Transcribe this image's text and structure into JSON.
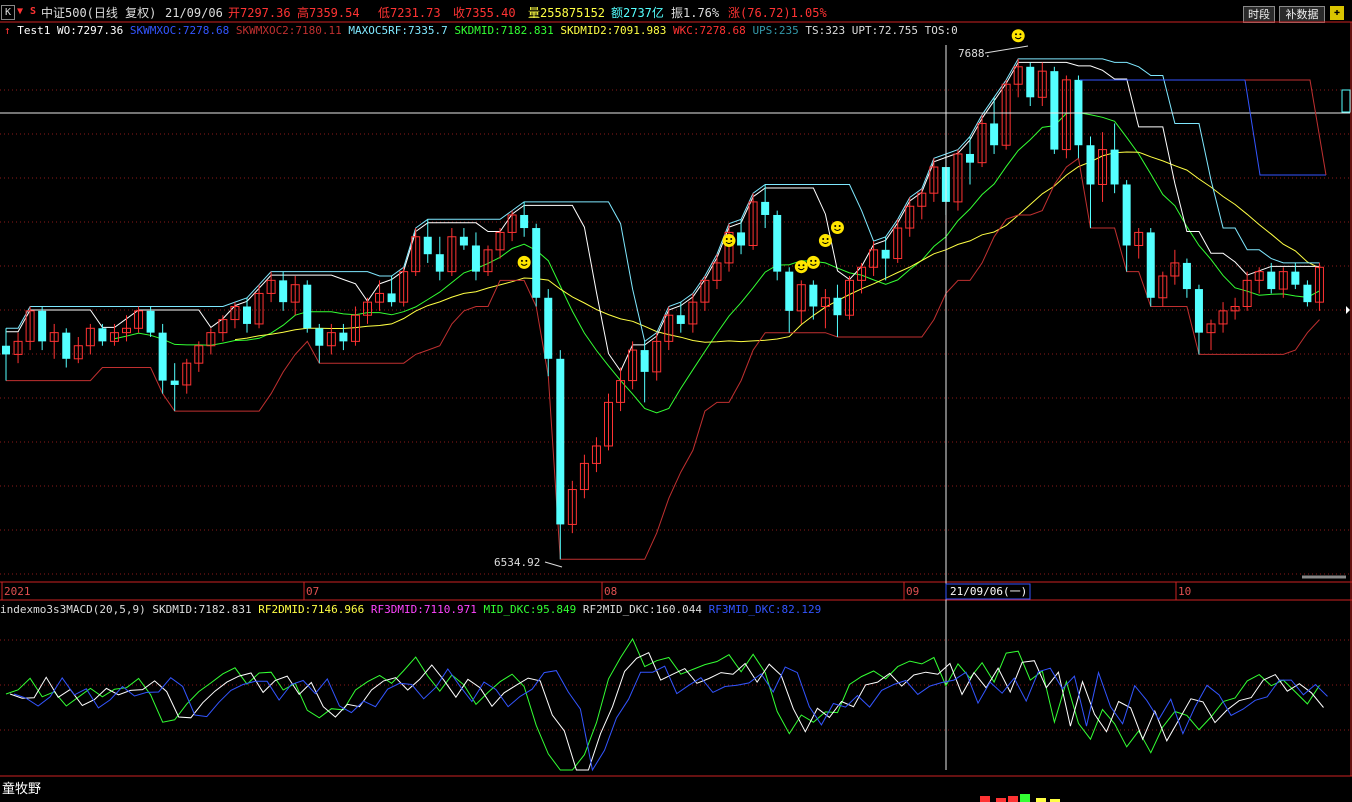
{
  "top": {
    "icons": [
      "K",
      "S"
    ],
    "stock_name": "中证500(日线 复权)",
    "date": "21/09/06",
    "open": "开7297.36",
    "high": "高7359.54",
    "low": "低7231.73",
    "close": "收7355.40",
    "volume": "量255875152",
    "amount": "额2737亿",
    "amplitude": "振1.76%",
    "change": "涨(76.72)1.05%",
    "buttons": [
      "时段",
      "补数据"
    ]
  },
  "legend_main": [
    {
      "text": "Test1",
      "color": "#ffffff"
    },
    {
      "text": "WO:7297.36",
      "color": "#ffffff"
    },
    {
      "text": "SKWMXOC:7278.68",
      "color": "#3355ff"
    },
    {
      "text": "SKWMXOC2:7180.11",
      "color": "#c03030"
    },
    {
      "text": "MAXOC5RF:7335.7",
      "color": "#7fe8ff"
    },
    {
      "text": "SKDMID:7182.831",
      "color": "#33ff33"
    },
    {
      "text": "SKDMID2:7091.983",
      "color": "#ffff44"
    },
    {
      "text": "WKC:7278.68",
      "color": "#ff3333"
    },
    {
      "text": "UPS:235",
      "color": "#3399aa"
    },
    {
      "text": "TS:323",
      "color": "#dddddd"
    },
    {
      "text": "UPT:72.755",
      "color": "#dddddd"
    },
    {
      "text": "TOS:0",
      "color": "#dddddd"
    }
  ],
  "price_labels": {
    "high": "7688.",
    "low": "6534.92"
  },
  "months": [
    "2021",
    "07",
    "08",
    "09",
    "21/09/06(一)",
    "10"
  ],
  "legend_sub": [
    {
      "text": "indexmo3s3MACD(20,5,9)",
      "color": "#dddddd"
    },
    {
      "text": "SKDMID:7182.831",
      "color": "#dddddd"
    },
    {
      "text": "RF2DMID:7146.966",
      "color": "#ffff44"
    },
    {
      "text": "RF3DMID:7110.971",
      "color": "#ff44ff"
    },
    {
      "text": "MID_DKC:95.849",
      "color": "#33ff33"
    },
    {
      "text": "RF2MID_DKC:160.044",
      "color": "#dddddd"
    },
    {
      "text": "RF3MID_DKC:82.129",
      "color": "#3355ff"
    }
  ],
  "bottom_name": "童牧野",
  "colors": {
    "up": "#ff3333",
    "down": "#54ffff",
    "grid": "#8b1a1a",
    "border": "#cc2222"
  },
  "candles": [
    [
      7030,
      7070,
      6950,
      7010
    ],
    [
      7010,
      7060,
      6990,
      7040
    ],
    [
      7040,
      7120,
      7020,
      7110
    ],
    [
      7110,
      7120,
      7020,
      7040
    ],
    [
      7040,
      7080,
      7000,
      7060
    ],
    [
      7060,
      7070,
      6980,
      7000
    ],
    [
      7000,
      7050,
      6990,
      7030
    ],
    [
      7030,
      7080,
      7010,
      7070
    ],
    [
      7070,
      7080,
      7030,
      7040
    ],
    [
      7040,
      7080,
      7030,
      7060
    ],
    [
      7060,
      7100,
      7040,
      7070
    ],
    [
      7070,
      7120,
      7060,
      7110
    ],
    [
      7110,
      7120,
      7050,
      7060
    ],
    [
      7060,
      7080,
      6920,
      6950
    ],
    [
      6950,
      6990,
      6880,
      6940
    ],
    [
      6940,
      7000,
      6920,
      6990
    ],
    [
      6990,
      7040,
      6970,
      7030
    ],
    [
      7030,
      7070,
      7010,
      7060
    ],
    [
      7060,
      7100,
      7040,
      7090
    ],
    [
      7090,
      7130,
      7070,
      7120
    ],
    [
      7120,
      7140,
      7060,
      7080
    ],
    [
      7080,
      7170,
      7070,
      7150
    ],
    [
      7150,
      7200,
      7130,
      7180
    ],
    [
      7180,
      7200,
      7110,
      7130
    ],
    [
      7130,
      7190,
      7100,
      7170
    ],
    [
      7170,
      7180,
      7060,
      7070
    ],
    [
      7070,
      7080,
      6990,
      7030
    ],
    [
      7030,
      7080,
      7010,
      7060
    ],
    [
      7060,
      7080,
      7020,
      7040
    ],
    [
      7040,
      7120,
      7030,
      7100
    ],
    [
      7100,
      7140,
      7080,
      7130
    ],
    [
      7130,
      7180,
      7110,
      7150
    ],
    [
      7150,
      7190,
      7120,
      7130
    ],
    [
      7130,
      7210,
      7120,
      7200
    ],
    [
      7200,
      7300,
      7190,
      7280
    ],
    [
      7280,
      7320,
      7220,
      7240
    ],
    [
      7240,
      7280,
      7180,
      7200
    ],
    [
      7200,
      7300,
      7190,
      7280
    ],
    [
      7280,
      7300,
      7250,
      7260
    ],
    [
      7260,
      7290,
      7180,
      7200
    ],
    [
      7200,
      7260,
      7190,
      7250
    ],
    [
      7250,
      7300,
      7230,
      7290
    ],
    [
      7290,
      7340,
      7270,
      7330
    ],
    [
      7330,
      7360,
      7280,
      7300
    ],
    [
      7300,
      7310,
      7120,
      7140
    ],
    [
      7140,
      7160,
      6960,
      7000
    ],
    [
      7000,
      7020,
      6540,
      6620
    ],
    [
      6620,
      6720,
      6600,
      6700
    ],
    [
      6700,
      6780,
      6680,
      6760
    ],
    [
      6760,
      6820,
      6740,
      6800
    ],
    [
      6800,
      6920,
      6790,
      6900
    ],
    [
      6900,
      6980,
      6880,
      6950
    ],
    [
      6950,
      7040,
      6930,
      7020
    ],
    [
      7020,
      7040,
      6900,
      6970
    ],
    [
      6970,
      7060,
      6950,
      7040
    ],
    [
      7040,
      7120,
      7020,
      7100
    ],
    [
      7100,
      7130,
      7060,
      7080
    ],
    [
      7080,
      7150,
      7060,
      7130
    ],
    [
      7130,
      7190,
      7110,
      7180
    ],
    [
      7180,
      7240,
      7160,
      7220
    ],
    [
      7220,
      7310,
      7200,
      7290
    ],
    [
      7290,
      7320,
      7240,
      7260
    ],
    [
      7260,
      7380,
      7250,
      7360
    ],
    [
      7360,
      7400,
      7300,
      7330
    ],
    [
      7330,
      7340,
      7180,
      7200
    ],
    [
      7200,
      7210,
      7060,
      7110
    ],
    [
      7110,
      7180,
      7080,
      7170
    ],
    [
      7170,
      7180,
      7090,
      7120
    ],
    [
      7120,
      7160,
      7070,
      7140
    ],
    [
      7140,
      7170,
      7050,
      7100
    ],
    [
      7100,
      7190,
      7090,
      7180
    ],
    [
      7180,
      7220,
      7150,
      7210
    ],
    [
      7210,
      7270,
      7190,
      7250
    ],
    [
      7250,
      7280,
      7180,
      7230
    ],
    [
      7230,
      7320,
      7220,
      7300
    ],
    [
      7300,
      7370,
      7280,
      7350
    ],
    [
      7350,
      7390,
      7320,
      7380
    ],
    [
      7380,
      7460,
      7360,
      7440
    ],
    [
      7440,
      7470,
      7330,
      7360
    ],
    [
      7360,
      7480,
      7340,
      7470
    ],
    [
      7470,
      7510,
      7400,
      7450
    ],
    [
      7450,
      7560,
      7440,
      7540
    ],
    [
      7540,
      7600,
      7470,
      7490
    ],
    [
      7490,
      7640,
      7480,
      7630
    ],
    [
      7630,
      7688,
      7600,
      7670
    ],
    [
      7670,
      7680,
      7580,
      7600
    ],
    [
      7600,
      7680,
      7580,
      7660
    ],
    [
      7660,
      7670,
      7470,
      7480
    ],
    [
      7480,
      7650,
      7460,
      7640
    ],
    [
      7640,
      7650,
      7460,
      7490
    ],
    [
      7490,
      7510,
      7300,
      7400
    ],
    [
      7400,
      7520,
      7360,
      7480
    ],
    [
      7480,
      7540,
      7380,
      7400
    ],
    [
      7400,
      7410,
      7200,
      7260
    ],
    [
      7260,
      7300,
      7230,
      7290
    ],
    [
      7290,
      7300,
      7120,
      7140
    ],
    [
      7140,
      7200,
      7120,
      7190
    ],
    [
      7190,
      7250,
      7170,
      7220
    ],
    [
      7220,
      7230,
      7140,
      7160
    ],
    [
      7160,
      7170,
      7010,
      7060
    ],
    [
      7060,
      7090,
      7020,
      7080
    ],
    [
      7080,
      7130,
      7060,
      7110
    ],
    [
      7110,
      7140,
      7090,
      7120
    ],
    [
      7120,
      7200,
      7110,
      7180
    ],
    [
      7180,
      7210,
      7150,
      7200
    ],
    [
      7200,
      7220,
      7150,
      7160
    ],
    [
      7160,
      7210,
      7140,
      7200
    ],
    [
      7200,
      7220,
      7160,
      7170
    ],
    [
      7170,
      7180,
      7120,
      7130
    ],
    [
      7130,
      7220,
      7110,
      7210
    ]
  ]
}
